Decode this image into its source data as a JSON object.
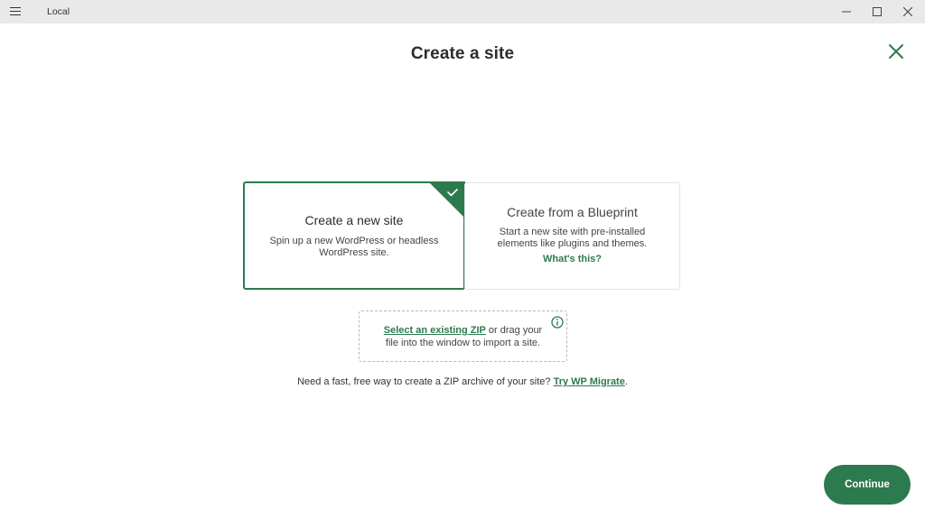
{
  "window": {
    "title": "Local"
  },
  "page": {
    "title": "Create a site"
  },
  "options": {
    "new_site": {
      "title": "Create a new site",
      "description": "Spin up a new WordPress or headless WordPress site."
    },
    "blueprint": {
      "title": "Create from a Blueprint",
      "description": "Start a new site with pre-installed elements like plugins and themes.",
      "link": "What's this?"
    }
  },
  "import": {
    "link": "Select an existing ZIP",
    "text": " or drag your file into the window to import a site."
  },
  "migrate": {
    "text": "Need a fast, free way to create a ZIP archive of your site? ",
    "link": "Try WP Migrate",
    "suffix": "."
  },
  "footer": {
    "continue_label": "Continue"
  },
  "colors": {
    "accent": "#2d7a4e",
    "titlebar": "#e9e9e9"
  },
  "icons": {
    "menu": "hamburger-icon",
    "minimize": "minimize-icon",
    "maximize": "maximize-icon",
    "window_close": "close-icon",
    "dialog_close": "close-x-icon",
    "selected": "checkmark-icon",
    "info": "info-icon"
  }
}
